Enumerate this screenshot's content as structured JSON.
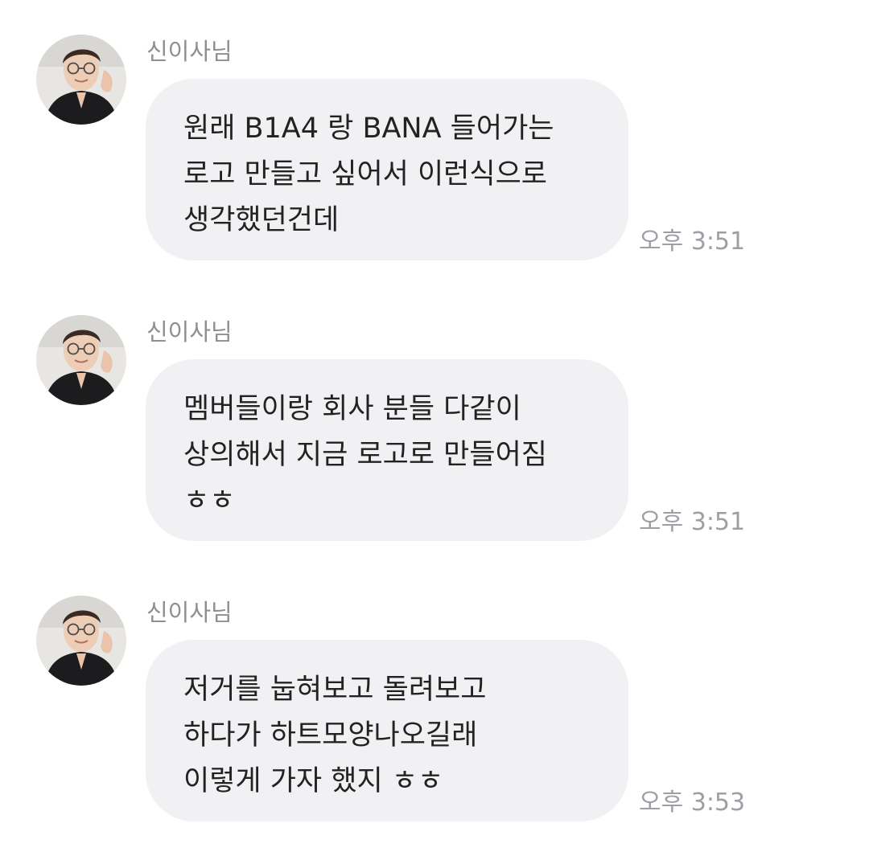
{
  "messages": [
    {
      "sender": "신이사님",
      "lines": [
        "원래 B1A4 랑 BANA 들어가는",
        "로고 만들고 싶어서 이런식으로",
        "생각했던건데"
      ],
      "time": "오후 3:51"
    },
    {
      "sender": "신이사님",
      "lines": [
        "멤버들이랑 회사 분들 다같이",
        "상의해서 지금 로고로 만들어짐",
        "ㅎㅎ"
      ],
      "time": "오후 3:51"
    },
    {
      "sender": "신이사님",
      "lines": [
        "저거를 눕혀보고 돌려보고",
        "하다가 하트모양나오길래",
        "이렇게 가자 했지 ㅎㅎ"
      ],
      "time": "오후 3:53"
    }
  ],
  "colors": {
    "background": "#ffffff",
    "bubble": "#f1f1f3",
    "message_text": "#222222",
    "sender_text": "#8e8e93",
    "time_text": "#9e9ea4"
  },
  "icons": {
    "avatar": "profile-photo"
  }
}
